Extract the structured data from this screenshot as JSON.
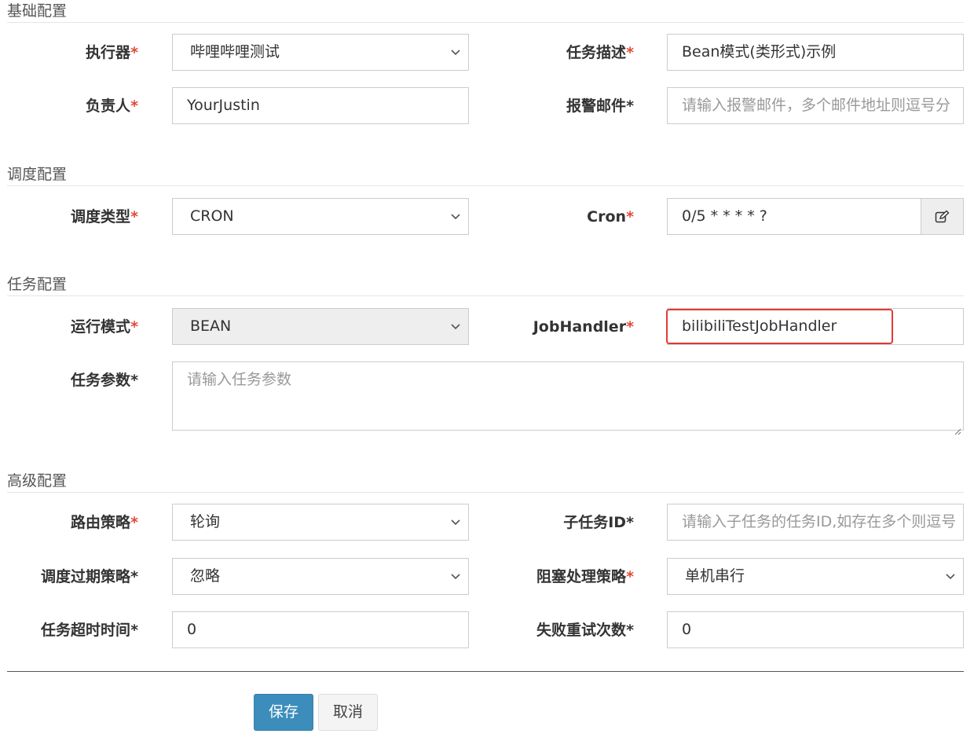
{
  "sections": {
    "basic": "基础配置",
    "schedule": "调度配置",
    "task": "任务配置",
    "advanced": "高级配置"
  },
  "fields": {
    "executor": {
      "label": "执行器",
      "value": "哔哩哔哩测试"
    },
    "job_desc": {
      "label": "任务描述",
      "value": "Bean模式(类形式)示例"
    },
    "author": {
      "label": "负责人",
      "value": "YourJustin"
    },
    "alarm_email": {
      "label": "报警邮件",
      "placeholder": "请输入报警邮件，多个邮件地址则逗号分"
    },
    "schedule_type": {
      "label": "调度类型",
      "value": "CRON"
    },
    "cron": {
      "label": "Cron",
      "value": "0/5 * * * * ?"
    },
    "glue_type": {
      "label": "运行模式",
      "value": "BEAN"
    },
    "job_handler": {
      "label": "JobHandler",
      "value": "bilibiliTestJobHandler"
    },
    "job_param": {
      "label": "任务参数",
      "placeholder": "请输入任务参数"
    },
    "route_strategy": {
      "label": "路由策略",
      "value": "轮询"
    },
    "child_job_id": {
      "label": "子任务ID",
      "placeholder": "请输入子任务的任务ID,如存在多个则逗号"
    },
    "misfire_strategy": {
      "label": "调度过期策略",
      "value": "忽略"
    },
    "block_strategy": {
      "label": "阻塞处理策略",
      "value": "单机串行"
    },
    "timeout": {
      "label": "任务超时时间",
      "value": "0"
    },
    "fail_retry": {
      "label": "失败重试次数",
      "value": "0"
    }
  },
  "required_mark": "*",
  "buttons": {
    "save": "保存",
    "cancel": "取消"
  },
  "icons": {
    "select_arrow": "chevron-down-icon",
    "cron_editor": "edit-icon",
    "textarea_resize": "resize-grip-icon"
  },
  "colors": {
    "required": "#dd4b39",
    "primary": "#3c8dbc",
    "highlight": "#e23b32"
  }
}
